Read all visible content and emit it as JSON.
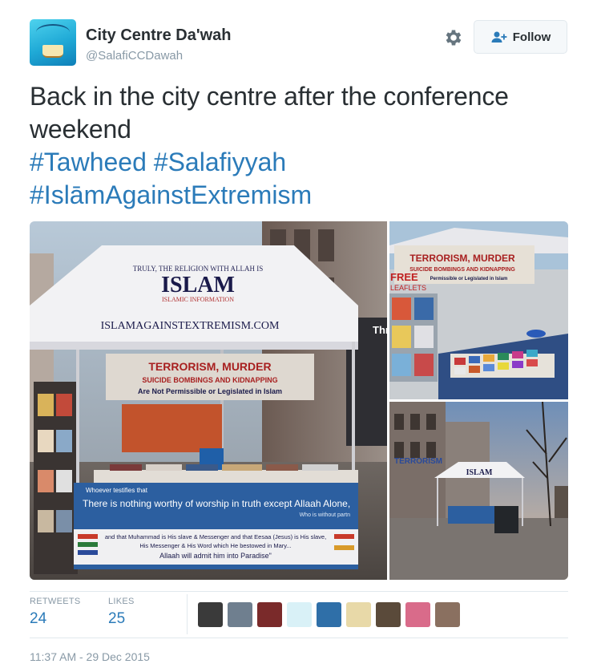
{
  "profile": {
    "name": "City Centre Da'wah",
    "handle": "@SalafiCCDawah",
    "avatar_icon": "book-logo-icon"
  },
  "actions": {
    "settings_icon": "gear-icon",
    "follow_label": "Follow",
    "follow_icon": "add-user-icon"
  },
  "tweet": {
    "text": "Back in the city centre after the conference weekend",
    "hashtags": [
      "#Tawheed #Salafiyyah",
      "#IslāmAgainstExtremism"
    ]
  },
  "media": {
    "main_photo": {
      "tent_top": "TRULY, THE RELIGION WITH ALLAH IS",
      "tent_main": "ISLAM",
      "tent_sub": "ISLAMIC INFORMATION",
      "tent_url": "ISLAMAGAINSTEXTREMISM.COM",
      "banner_line1": "TERRORISM, MURDER",
      "banner_line2": "SUICIDE BOMBINGS AND KIDNAPPING",
      "banner_line3": "Are Not Permissible or Legislated in Islam",
      "table_small": "Whoever testifies that",
      "table_main": "There is nothing worthy of worship in truth except Allaah Alone,",
      "table_sub": "Who is without partn",
      "table_line2": "and that Muhammad is His slave & Messenger and that Eesaa (Jesus) is His slave,",
      "table_line3": "His Messenger & His Word which He bestowed in Mary...",
      "table_line4": "Allaah will admit him into Paradise\"",
      "shop_sign": "Thre"
    },
    "top_right_photo": {
      "banner_line1": "TERRORISM, MURDER",
      "banner_line2": "SUICIDE BOMBINGS AND KIDNAPPING",
      "banner_line3": "Permissible or Legislated in Islam",
      "free_sign": "FREE",
      "leaflets": "LEAFLETS"
    },
    "bottom_right_photo": {
      "tent_label": "ISLAM",
      "shop_sign": "TERRORISM"
    }
  },
  "stats": {
    "retweets_label": "RETWEETS",
    "retweets_value": "24",
    "likes_label": "LIKES",
    "likes_value": "25"
  },
  "likers": [
    {
      "name": "liker-avatar-1",
      "color": "#3a3a3a"
    },
    {
      "name": "liker-avatar-2",
      "color": "#6f7f8f"
    },
    {
      "name": "liker-avatar-3",
      "color": "#7a2a2a"
    },
    {
      "name": "liker-avatar-4",
      "color": "#d9f1f7"
    },
    {
      "name": "liker-avatar-5",
      "color": "#2f6fa8"
    },
    {
      "name": "liker-avatar-6",
      "color": "#e8d9a8"
    },
    {
      "name": "liker-avatar-7",
      "color": "#5a4a3a"
    },
    {
      "name": "liker-avatar-8",
      "color": "#d96b8a"
    },
    {
      "name": "liker-avatar-9",
      "color": "#8a7060"
    }
  ],
  "timestamp": "11:37 AM - 29 Dec 2015",
  "colors": {
    "link": "#2b7bb9",
    "muted": "#8899a6",
    "text": "#292f33",
    "border": "#e1e8ed"
  }
}
